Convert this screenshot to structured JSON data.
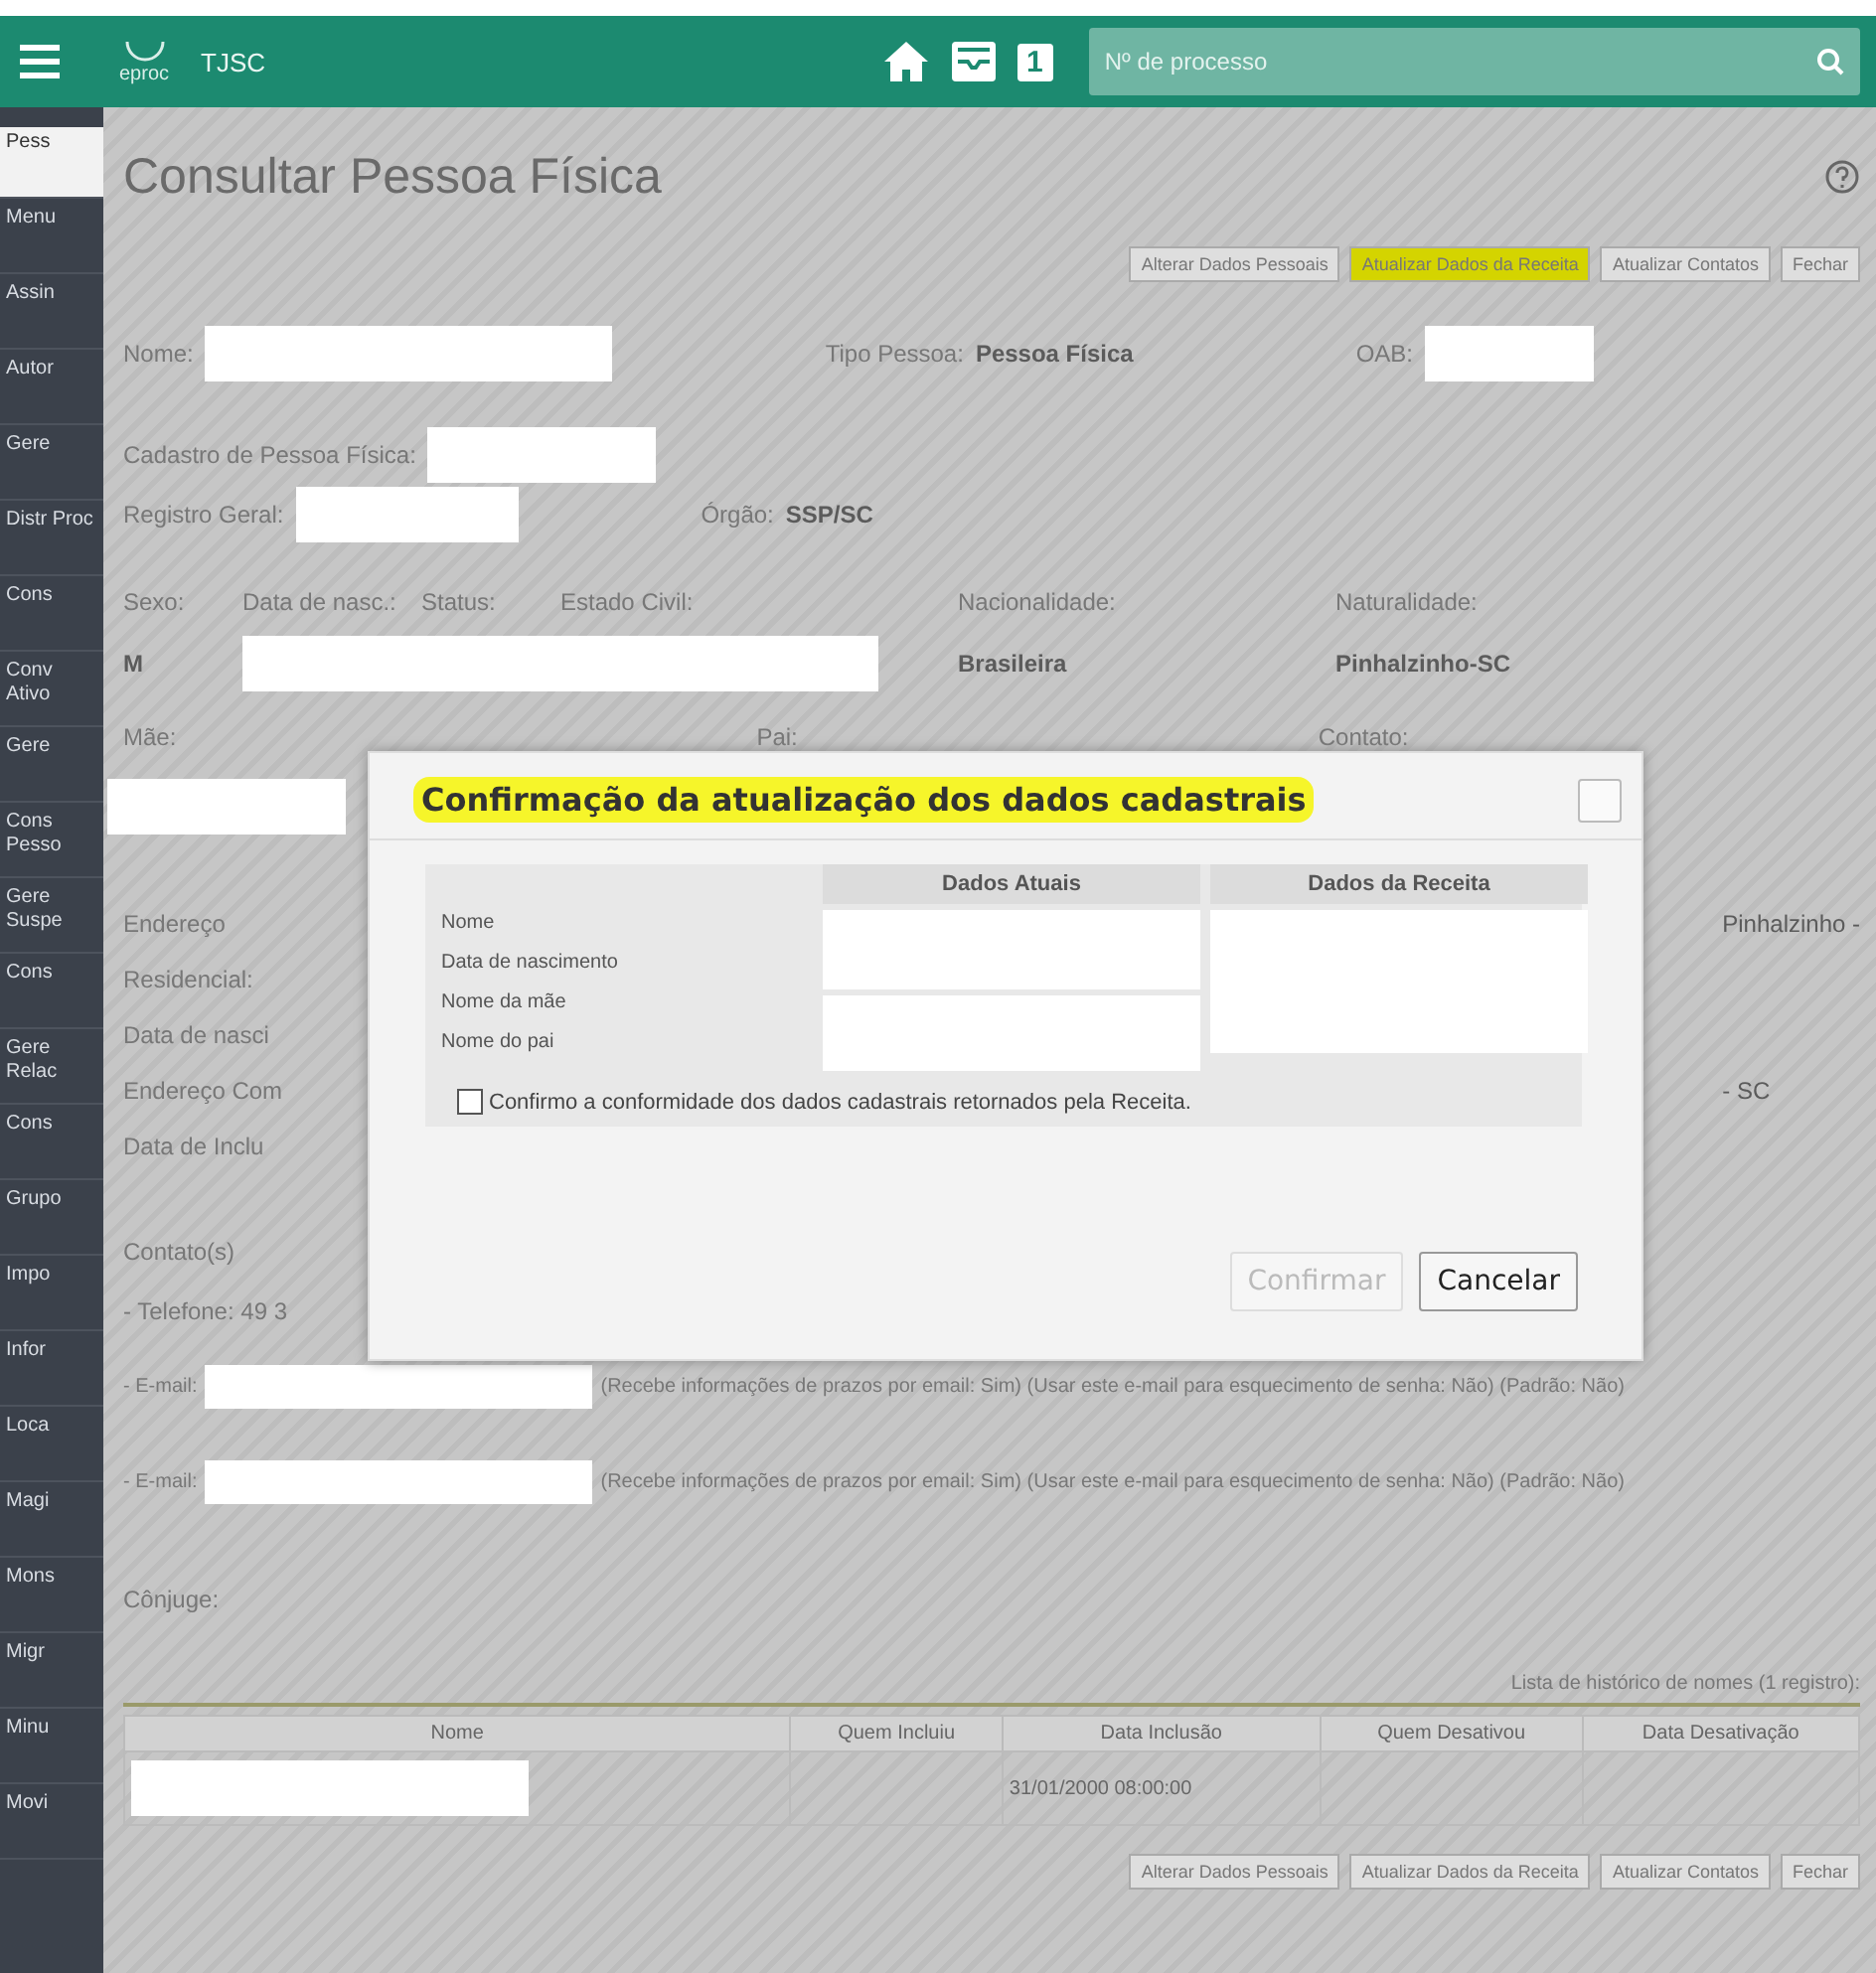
{
  "topbar": {
    "logo": "eproc",
    "court": "TJSC",
    "badge": "1",
    "search": {
      "placeholder": "Nº de processo"
    }
  },
  "sidebar": {
    "items": [
      {
        "label": "Pess",
        "selected": true
      },
      {
        "label": "Menu",
        "selected": false
      },
      {
        "label": "Assin",
        "selected": false
      },
      {
        "label": "Autor",
        "selected": false
      },
      {
        "label": "Gere",
        "selected": false
      },
      {
        "label": "Distr Proc",
        "selected": false
      },
      {
        "label": "Cons",
        "selected": false
      },
      {
        "label": "Conv Ativo",
        "selected": false
      },
      {
        "label": "Gere",
        "selected": false
      },
      {
        "label": "Cons Pesso",
        "selected": false
      },
      {
        "label": "Gere Suspe",
        "selected": false
      },
      {
        "label": "Cons",
        "selected": false
      },
      {
        "label": "Gere Relac",
        "selected": false
      },
      {
        "label": "Cons",
        "selected": false
      },
      {
        "label": "Grupo",
        "selected": false
      },
      {
        "label": "Impo",
        "selected": false
      },
      {
        "label": "Infor",
        "selected": false
      },
      {
        "label": "Loca",
        "selected": false
      },
      {
        "label": "Magi",
        "selected": false
      },
      {
        "label": "Mons",
        "selected": false
      },
      {
        "label": "Migr",
        "selected": false
      },
      {
        "label": "Minu",
        "selected": false
      },
      {
        "label": "Movi",
        "selected": false
      }
    ]
  },
  "page": {
    "title": "Consultar Pessoa Física",
    "top_buttons": [
      {
        "label": "Alterar Dados Pessoais",
        "highlighted": false
      },
      {
        "label": "Atualizar Dados da Receita",
        "highlighted": true
      },
      {
        "label": "Atualizar Contatos",
        "highlighted": false
      },
      {
        "label": "Fechar",
        "highlighted": false
      }
    ],
    "row1": [
      {
        "label": "Nome:",
        "kind": "redacted"
      },
      {
        "label": "Tipo Pessoa:",
        "kind": "text",
        "value": "Pessoa Física"
      },
      {
        "label": "OAB:",
        "kind": "redacted"
      }
    ],
    "row2": [
      {
        "label": "Cadastro de Pessoa Física:",
        "kind": "redacted"
      }
    ],
    "row3": [
      {
        "label": "Registro Geral:",
        "kind": "redacted"
      },
      {
        "label": "Órgão:",
        "kind": "text",
        "value": "SSP/SC"
      }
    ],
    "details": [
      {
        "label": "Sexo:",
        "kind": "text",
        "value": "M"
      },
      {
        "label": "Data de nasc.:",
        "kind": "redacted"
      },
      {
        "label": "Status:",
        "kind": "redacted"
      },
      {
        "label": "Estado Civil:",
        "kind": "none"
      },
      {
        "label": "Nacionalidade:",
        "kind": "text",
        "value": "Brasileira"
      },
      {
        "label": "Naturalidade:",
        "kind": "text",
        "value": "Pinhalzinho-SC"
      }
    ],
    "parents": [
      {
        "label": "Mãe:"
      },
      {
        "label": "Pai:"
      },
      {
        "label": "Contato:"
      }
    ],
    "address_lines": [
      "Endereço",
      "Residencial:",
      "Data de nasci",
      "Endereço Com",
      "Data de Inclu"
    ],
    "address_right": [
      "Pinhalzinho -",
      "- SC"
    ],
    "contacts_title": "Contato(s)",
    "phone": "- Telefone: 49 3",
    "emails": [
      {
        "prefix": "- E-mail:",
        "text": "(Recebe informações de prazos por email: Sim) (Usar este e-mail para esquecimento de senha: Não) (Padrão: Não)"
      },
      {
        "prefix": "- E-mail:",
        "text": "(Recebe informações de prazos por email: Sim) (Usar este e-mail para esquecimento de senha: Não) (Padrão: Não)"
      }
    ],
    "spouse": "Cônjuge:",
    "history": {
      "caption": "Lista de histórico de nomes (1 registro):",
      "columns": [
        "Nome",
        "Quem Incluiu",
        "Data Inclusão",
        "Quem Desativou",
        "Data Desativação"
      ],
      "rows": [
        {
          "name": {
            "kind": "redacted"
          },
          "added_on": "31/01/2000 08:00:00"
        }
      ]
    },
    "bottom_buttons": [
      {
        "label": "Alterar Dados Pessoais",
        "highlighted": false
      },
      {
        "label": "Atualizar Dados da Receita",
        "highlighted": false
      },
      {
        "label": "Atualizar Contatos",
        "highlighted": false
      },
      {
        "label": "Fechar",
        "highlighted": false
      }
    ]
  },
  "dialog": {
    "title": "Confirmação da atualização dos dados cadastrais",
    "title_highlighted": true,
    "columns": [
      "Dados Atuais",
      "Dados da Receita"
    ],
    "fields": [
      "Nome",
      "Data de nascimento",
      "Nome da mãe",
      "Nome do pai"
    ],
    "confirm_check": {
      "label": "Confirmo a conformidade dos dados cadastrais retornados pela Receita.",
      "checked": false
    },
    "buttons": [
      {
        "label": "Confirmar",
        "disabled": true
      },
      {
        "label": "Cancelar",
        "disabled": false
      }
    ]
  }
}
